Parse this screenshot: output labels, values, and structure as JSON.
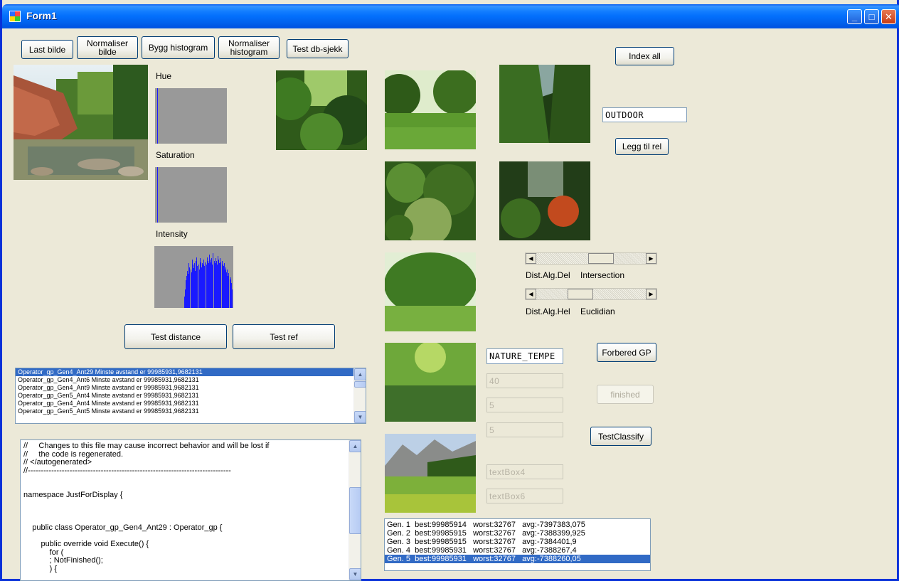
{
  "window": {
    "title": "Form1"
  },
  "toolbar": {
    "last_bilde": "Last bilde",
    "normaliser_bilde": "Normaliser\nbilde",
    "bygg_histogram": "Bygg histogram",
    "normaliser_histogram": "Normaliser\nhistogram",
    "test_db": "Test db-sjekk"
  },
  "labels": {
    "hue": "Hue",
    "saturation": "Saturation",
    "intensity": "Intensity"
  },
  "buttons": {
    "index_all": "Index all",
    "legg_til_rel": "Legg til rel",
    "test_distance": "Test distance",
    "test_ref": "Test ref",
    "forbered_gp": "Forbered GP",
    "finished": "finished",
    "test_classify": "TestClassify"
  },
  "fields": {
    "outdoor": "OUTDOOR",
    "nature": "NATURE_TEMPE",
    "f40": "40",
    "f5a": "5",
    "f5b": "5",
    "textbox4": "textBox4",
    "textbox6": "textBox6"
  },
  "dist": {
    "del_label": "Dist.Alg.Del",
    "del_value": "Intersection",
    "del_position": 0.62,
    "hel_label": "Dist.Alg.Hel",
    "hel_value": "Euclidian",
    "hel_position": 0.37
  },
  "histograms": {
    "hue_bar_position": 0.03,
    "saturation_bar_position": 0.03,
    "intensity_values": [
      0,
      0,
      0,
      0,
      0,
      0,
      0,
      0,
      0,
      0,
      0,
      0,
      0,
      0,
      0,
      0,
      0,
      0,
      0,
      0,
      0,
      0,
      0,
      0,
      0,
      0,
      0,
      0,
      0,
      0,
      0,
      0,
      0,
      0,
      0,
      0,
      0,
      0,
      0.18,
      0.3,
      0.45,
      0.52,
      0.6,
      0.55,
      0.72,
      0.66,
      0.62,
      0.58,
      0.78,
      0.7,
      0.64,
      0.72,
      0.6,
      0.76,
      0.82,
      0.68,
      0.7,
      0.62,
      0.8,
      0.74,
      0.66,
      0.72,
      0.7,
      0.78,
      0.68,
      0.74,
      0.7,
      0.82,
      0.76,
      0.72,
      0.86,
      0.78,
      0.74,
      0.8,
      0.7,
      0.88,
      0.76,
      0.72,
      0.8,
      0.76,
      0.7,
      0.84,
      0.78,
      0.72,
      0.8,
      0.74,
      0.76,
      0.7,
      0.68,
      0.72,
      0.62,
      0.66,
      0.58,
      0.62,
      0.52,
      0.56,
      0.46,
      0.5,
      0.4,
      0.3,
      0.0
    ]
  },
  "results_list": [
    "Operator_gp_Gen4_Ant29 Minste avstand er 99985931,9682131",
    "Operator_gp_Gen4_Ant6 Minste avstand er 99985931,9682131",
    "Operator_gp_Gen4_Ant9 Minste avstand er 99985931,9682131",
    "Operator_gp_Gen5_Ant4 Minste avstand er 99985931,9682131",
    "Operator_gp_Gen4_Ant4 Minste avstand er 99985931,9682131",
    "Operator_gp_Gen5_Ant5 Minste avstand er 99985931,9682131"
  ],
  "code_lines": [
    "//     Changes to this file may cause incorrect behavior and will be lost if",
    "//     the code is regenerated.",
    "// </autogenerated>",
    "//------------------------------------------------------------------------------",
    "",
    "",
    "namespace JustForDisplay {",
    "",
    "",
    "",
    "    public class Operator_gp_Gen4_Ant29 : Operator_gp {",
    "",
    "        public override void Execute() {",
    "            for (",
    "            ; NotFinished();",
    "            ) {"
  ],
  "generations": [
    "Gen. 1  best:99985914   worst:32767   avg:-7397383,075",
    "Gen. 2  best:99985915   worst:32767   avg:-7388399,925",
    "Gen. 3  best:99985915   worst:32767   avg:-7384401,9",
    "Gen. 4  best:99985931   worst:32767   avg:-7388267,4",
    "Gen. 5  best:99985931   worst:32767   avg:-7388260,05"
  ]
}
